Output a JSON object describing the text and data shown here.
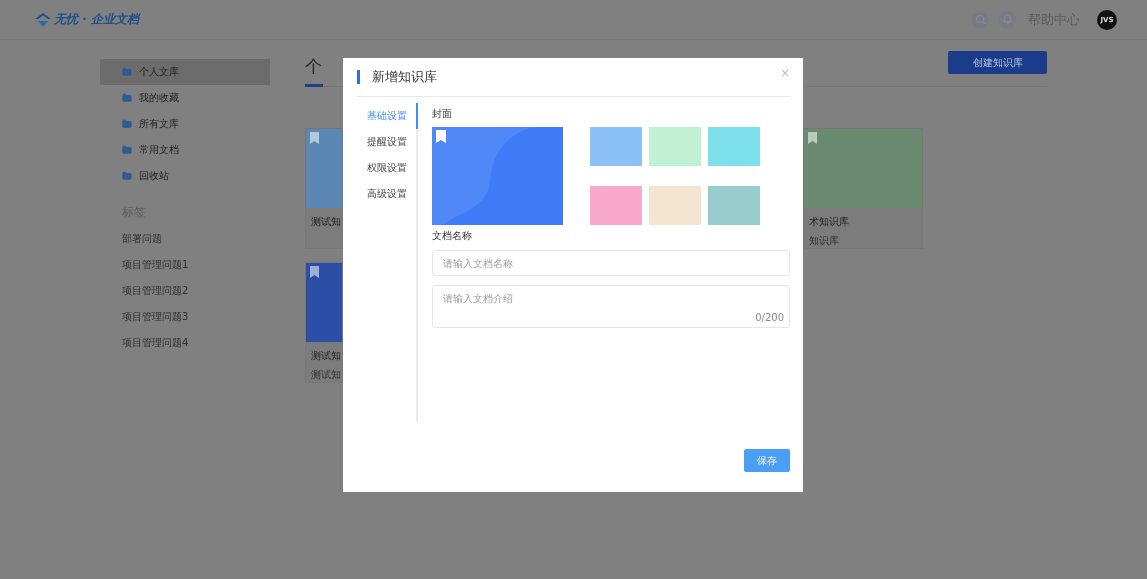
{
  "header": {
    "logo": "无忧 · 企业文档",
    "help": "帮助中心",
    "avatar": "JVS"
  },
  "sidebar": {
    "items": [
      {
        "label": "个人文库",
        "selected": true
      },
      {
        "label": "我的收藏",
        "selected": false
      },
      {
        "label": "所有文库",
        "selected": false
      },
      {
        "label": "常用文档",
        "selected": false
      },
      {
        "label": "回收站",
        "selected": false
      }
    ],
    "tags_title": "标签",
    "tags": [
      "部署问题",
      "项目管理问题1",
      "项目管理问题2",
      "项目管理问题3",
      "项目管理问题4"
    ]
  },
  "main": {
    "title": "个",
    "create_button": "创建知识库",
    "rows": [
      {
        "left": {
          "title": "测试知",
          "color": "#5b87b4"
        },
        "right": {
          "title": "术知识库",
          "subtitle": "知识库",
          "color": "#6a8a70"
        }
      },
      {
        "left": {
          "title": "测试知",
          "subtitle": "测试知",
          "color": "#2d4ea6"
        }
      }
    ]
  },
  "dialog": {
    "title": "新增知识库",
    "close": "×",
    "nav": [
      {
        "label": "基础设置",
        "selected": true
      },
      {
        "label": "提醒设置",
        "selected": false
      },
      {
        "label": "权限设置",
        "selected": false
      },
      {
        "label": "高级设置",
        "selected": false
      }
    ],
    "cover_label": "封面",
    "cover_swatches": [
      {
        "color": "#8ac2f7"
      },
      {
        "color": "#c2f0d3"
      },
      {
        "color": "#7ee0ec"
      },
      {
        "color": "#f8a8c8"
      },
      {
        "color": "#f3e5d0"
      },
      {
        "color": "#98cccd"
      }
    ],
    "name_label": "文档名称",
    "name_field": {
      "placeholder": "请输入文档名称"
    },
    "intro_field": {
      "placeholder": "请输入文档介绍",
      "counter": "0/200"
    },
    "save_button": "保存"
  }
}
